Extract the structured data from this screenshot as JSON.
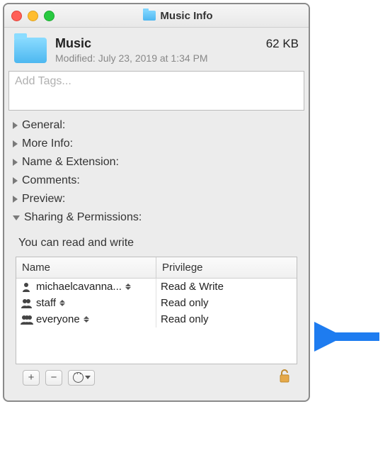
{
  "titlebar": {
    "title": "Music Info"
  },
  "header": {
    "folder_name": "Music",
    "size": "62 KB",
    "modified": "Modified: July 23, 2019 at 1:34 PM"
  },
  "tags": {
    "placeholder": "Add Tags..."
  },
  "sections": {
    "general": "General:",
    "more_info": "More Info:",
    "name_ext": "Name & Extension:",
    "comments": "Comments:",
    "preview": "Preview:",
    "sharing": "Sharing & Permissions:"
  },
  "permissions": {
    "caption": "You can read and write",
    "headers": {
      "name": "Name",
      "privilege": "Privilege"
    },
    "rows": [
      {
        "icon": "single",
        "name": "michaelcavanna...",
        "privilege": "Read & Write"
      },
      {
        "icon": "double",
        "name": "staff",
        "privilege": "Read only"
      },
      {
        "icon": "triple",
        "name": "everyone",
        "privilege": "Read only"
      }
    ]
  },
  "footer": {
    "add": "+",
    "remove": "−"
  },
  "colors": {
    "arrow": "#1e7cf0"
  }
}
